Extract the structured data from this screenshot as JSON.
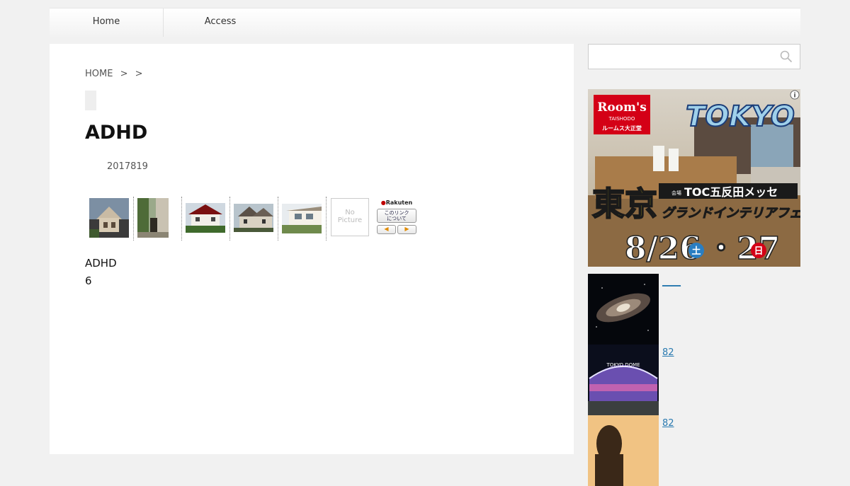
{
  "nav": {
    "home": "Home",
    "access": "Access"
  },
  "breadcrumb": {
    "home": "HOME",
    "sep1": ">",
    "sep2": ">"
  },
  "article": {
    "title": "ADHD",
    "date": "2017819",
    "lines": [
      "ADHD",
      "6"
    ]
  },
  "widget": {
    "nopic_line1": "No",
    "nopic_line2": "Picture",
    "rakuten_logo": "Rakuten",
    "about_line1": "このリンク",
    "about_line2": "について",
    "prev_arrow": "◀",
    "next_arrow": "▶"
  },
  "ad": {
    "store_brand": "Room's",
    "store_sub": "TAISHODO",
    "store_jp": "ルームス大正堂",
    "city": "TOKYO",
    "venue": "TOC五反田メッセ",
    "big_kanji": "東京",
    "fair": "グランドインテリアフェア",
    "venue_tag": "会場",
    "date_text": "8/26",
    "day1": "土",
    "date2": "・27",
    "day2": "日",
    "info": "i"
  },
  "related": [
    {
      "link": "____"
    },
    {
      "link": "82",
      "image_text": "TOKYO DOME"
    },
    {
      "link": "82"
    }
  ],
  "colors": {
    "link": "#2a7ab0",
    "ad_yellow": "#f5e31b",
    "ad_red": "#d40016"
  }
}
